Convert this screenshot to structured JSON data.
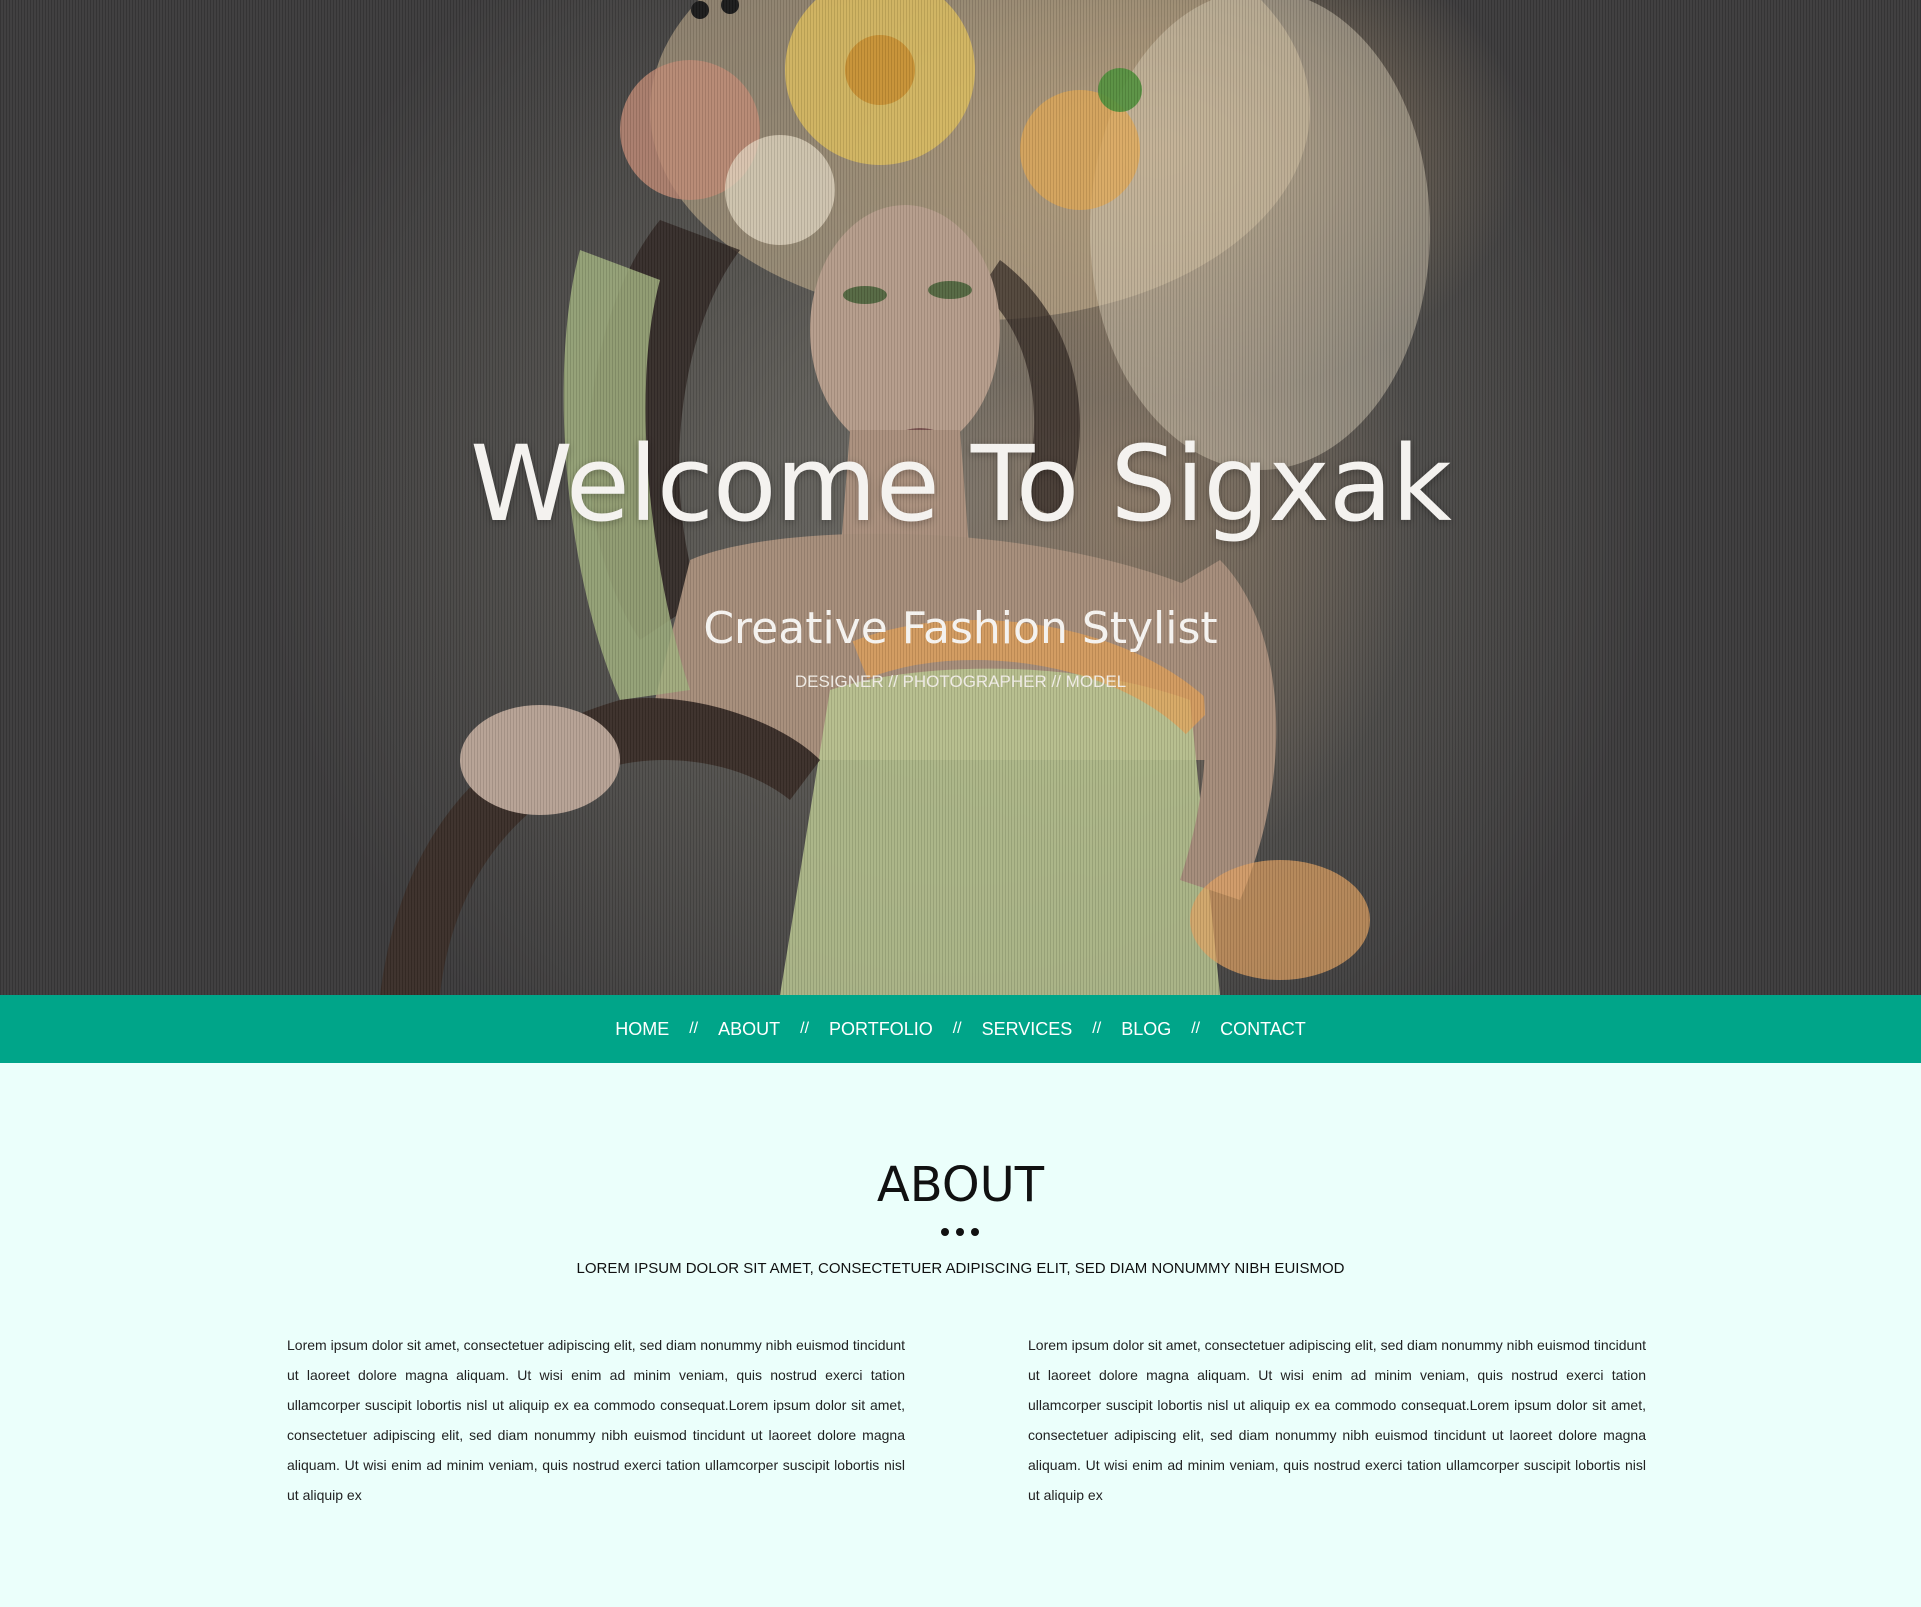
{
  "hero": {
    "title": "Welcome To Sigxak",
    "subtitle": "Creative Fashion Stylist",
    "roles": "DESIGNER // PHOTOGRAPHER // MODEL"
  },
  "nav": {
    "items": [
      "HOME",
      "ABOUT",
      "PORTFOLIO",
      "SERVICES",
      "BLOG",
      "CONTACT"
    ],
    "separator": "//"
  },
  "about": {
    "heading": "ABOUT",
    "tagline": "LOREM IPSUM DOLOR SIT AMET, CONSECTETUER ADIPISCING ELIT, SED DIAM NONUMMY NIBH EUISMOD",
    "columns": [
      "Lorem ipsum dolor sit amet, consectetuer adipiscing elit, sed diam nonummy nibh euismod tincidunt ut laoreet dolore magna aliquam. Ut wisi enim ad minim veniam, quis nostrud exerci tation ullamcorper suscipit lobortis nisl ut aliquip ex ea commodo consequat.Lorem ipsum dolor sit amet, consectetuer adipiscing elit, sed diam nonummy nibh euismod tincidunt ut laoreet dolore magna aliquam. Ut wisi enim ad minim veniam, quis nostrud exerci tation ullamcorper suscipit lobortis nisl ut aliquip ex",
      "Lorem ipsum dolor sit amet, consectetuer adipiscing elit, sed diam nonummy nibh euismod tincidunt ut laoreet dolore magna aliquam. Ut wisi enim ad minim veniam, quis nostrud exerci tation ullamcorper suscipit lobortis nisl ut aliquip ex ea commodo consequat.Lorem ipsum dolor sit amet, consectetuer adipiscing elit, sed diam nonummy nibh euismod tincidunt ut laoreet dolore magna aliquam. Ut wisi enim ad minim veniam, quis nostrud exerci tation ullamcorper suscipit lobortis nisl ut aliquip ex"
    ]
  },
  "colors": {
    "nav_background": "#00a589",
    "page_background": "#ebfffb",
    "heading_text": "#111111"
  }
}
